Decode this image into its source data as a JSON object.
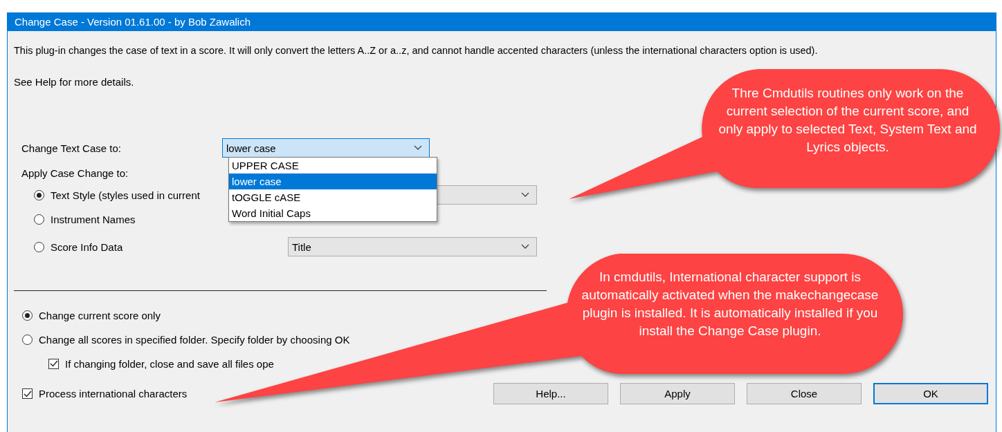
{
  "window": {
    "title": "Change Case - Version 01.61.00 - by Bob Zawalich"
  },
  "description": "This plug-in changes the case of text in a score. It will only convert the letters A..Z or a..z, and cannot handle accented characters (unless the international characters option is used).",
  "help_note": "See Help for more details.",
  "text_case": {
    "label": "Change Text Case to:",
    "value": "lower case",
    "expanded": true,
    "options": [
      {
        "label": "UPPER CASE",
        "selected": false
      },
      {
        "label": "lower case",
        "selected": true
      },
      {
        "label": "tOGGLE cASE",
        "selected": false
      },
      {
        "label": "Word Initial Caps",
        "selected": false
      }
    ]
  },
  "apply_to": {
    "label": "Apply Case Change to:",
    "options": [
      {
        "label": "Text Style (styles used in current",
        "selected": true,
        "kind": "combo"
      },
      {
        "label": "Instrument Names",
        "selected": false,
        "kind": "plain"
      },
      {
        "label": "Score Info Data",
        "selected": false,
        "kind": "combo",
        "value": "Title"
      }
    ]
  },
  "scope": [
    {
      "label": "Change current score only",
      "selected": true
    },
    {
      "label": "Change all scores in specified folder. Specify folder by choosing OK",
      "selected": false
    }
  ],
  "close_save": {
    "label": "If changing folder, close and save all files ope",
    "checked": true
  },
  "international": {
    "label": "Process international characters",
    "checked": true
  },
  "buttons": [
    {
      "label": "Help...",
      "default": false
    },
    {
      "label": "Apply",
      "default": false
    },
    {
      "label": "Close",
      "default": false
    },
    {
      "label": "OK",
      "default": true
    }
  ],
  "callouts": [
    {
      "text": "Thre Cmdutils routines only work on the current selection of the current score, and only apply to selected Text, System Text and Lyrics objects."
    },
    {
      "text": "In cmdutils, International character support is automatically activated when the makechangecase plugin is installed. It is automatically installed if you install the Change Case plugin."
    }
  ]
}
